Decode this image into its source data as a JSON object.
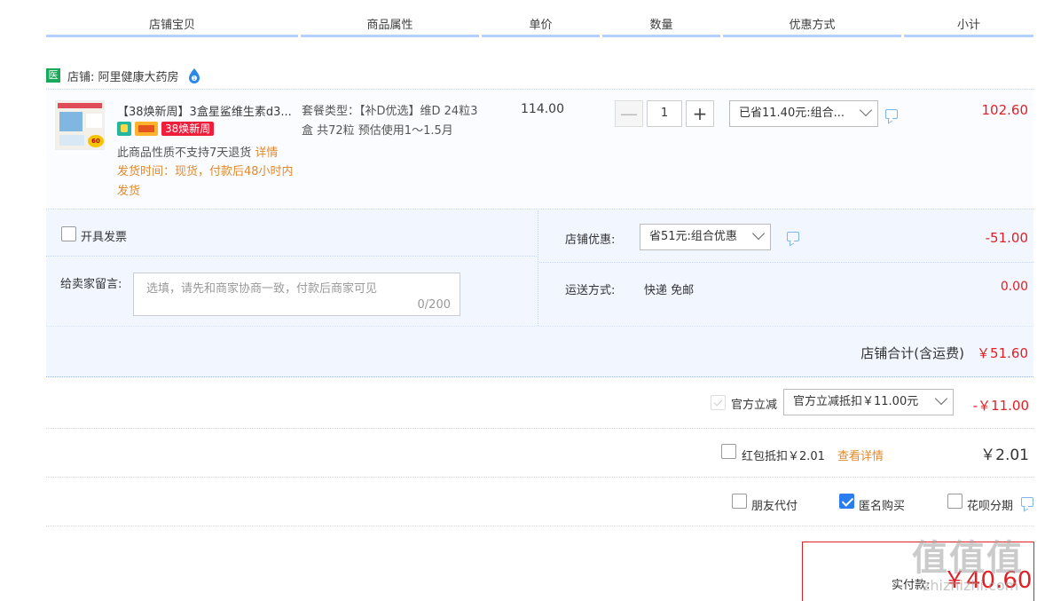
{
  "header": {
    "columns": [
      "店铺宝贝",
      "商品属性",
      "单价",
      "数量",
      "优惠方式",
      "小计"
    ]
  },
  "shop": {
    "badge": "医",
    "name": "店铺: 阿里健康大药房"
  },
  "item": {
    "title": "【38焕新周】3盒星鲨维生素d3...",
    "tag_text": "38焕新周",
    "note": "此商品性质不支持7天退货",
    "note_link": "详情",
    "ship_time": "发货时间：现货，付款后48小时内发货",
    "attr": "套餐类型：【补D优选】维D 24粒3盒 共72粒 预估使用1～1.5月",
    "unit_price": "114.00",
    "quantity": "1",
    "minus": "—",
    "plus": "+",
    "discount_select": "已省11.40元:组合...",
    "subtotal": "102.60",
    "thumb_badge": "60"
  },
  "invoice": {
    "label": "开具发票",
    "checked": false
  },
  "message": {
    "label": "给卖家留言:",
    "placeholder": "选填，请先和商家协商一致，付款后商家可见",
    "counter": "0/200"
  },
  "shop_discount": {
    "label": "店铺优惠:",
    "select": "省51元:组合优惠",
    "value": "-51.00"
  },
  "shipping": {
    "label": "运送方式:",
    "method": "快递 免邮",
    "value": "0.00"
  },
  "shop_total": {
    "label": "店铺合计(含运费)",
    "value": "￥51.60"
  },
  "official": {
    "label": "官方立减",
    "select": "官方立减抵扣￥11.00元",
    "value": "-￥11.00"
  },
  "red_packet": {
    "label": "红包抵扣￥2.01",
    "link": "查看详情",
    "value": "￥2.01"
  },
  "options": {
    "friend_pay": "朋友代付",
    "anonymous": "匿名购买",
    "huabei": "花呗分期"
  },
  "pay": {
    "label": "实付款:",
    "value": "￥40.60"
  },
  "watermark": {
    "text": "值值值",
    "url": "zhizhizhi.com"
  },
  "colors": {
    "accent_blue": "#2a7cf0",
    "price_red": "#e02025",
    "header_line": "#b2d1ff",
    "panel_bg": "#f2f7ff",
    "link_orange": "#e08a2e"
  }
}
